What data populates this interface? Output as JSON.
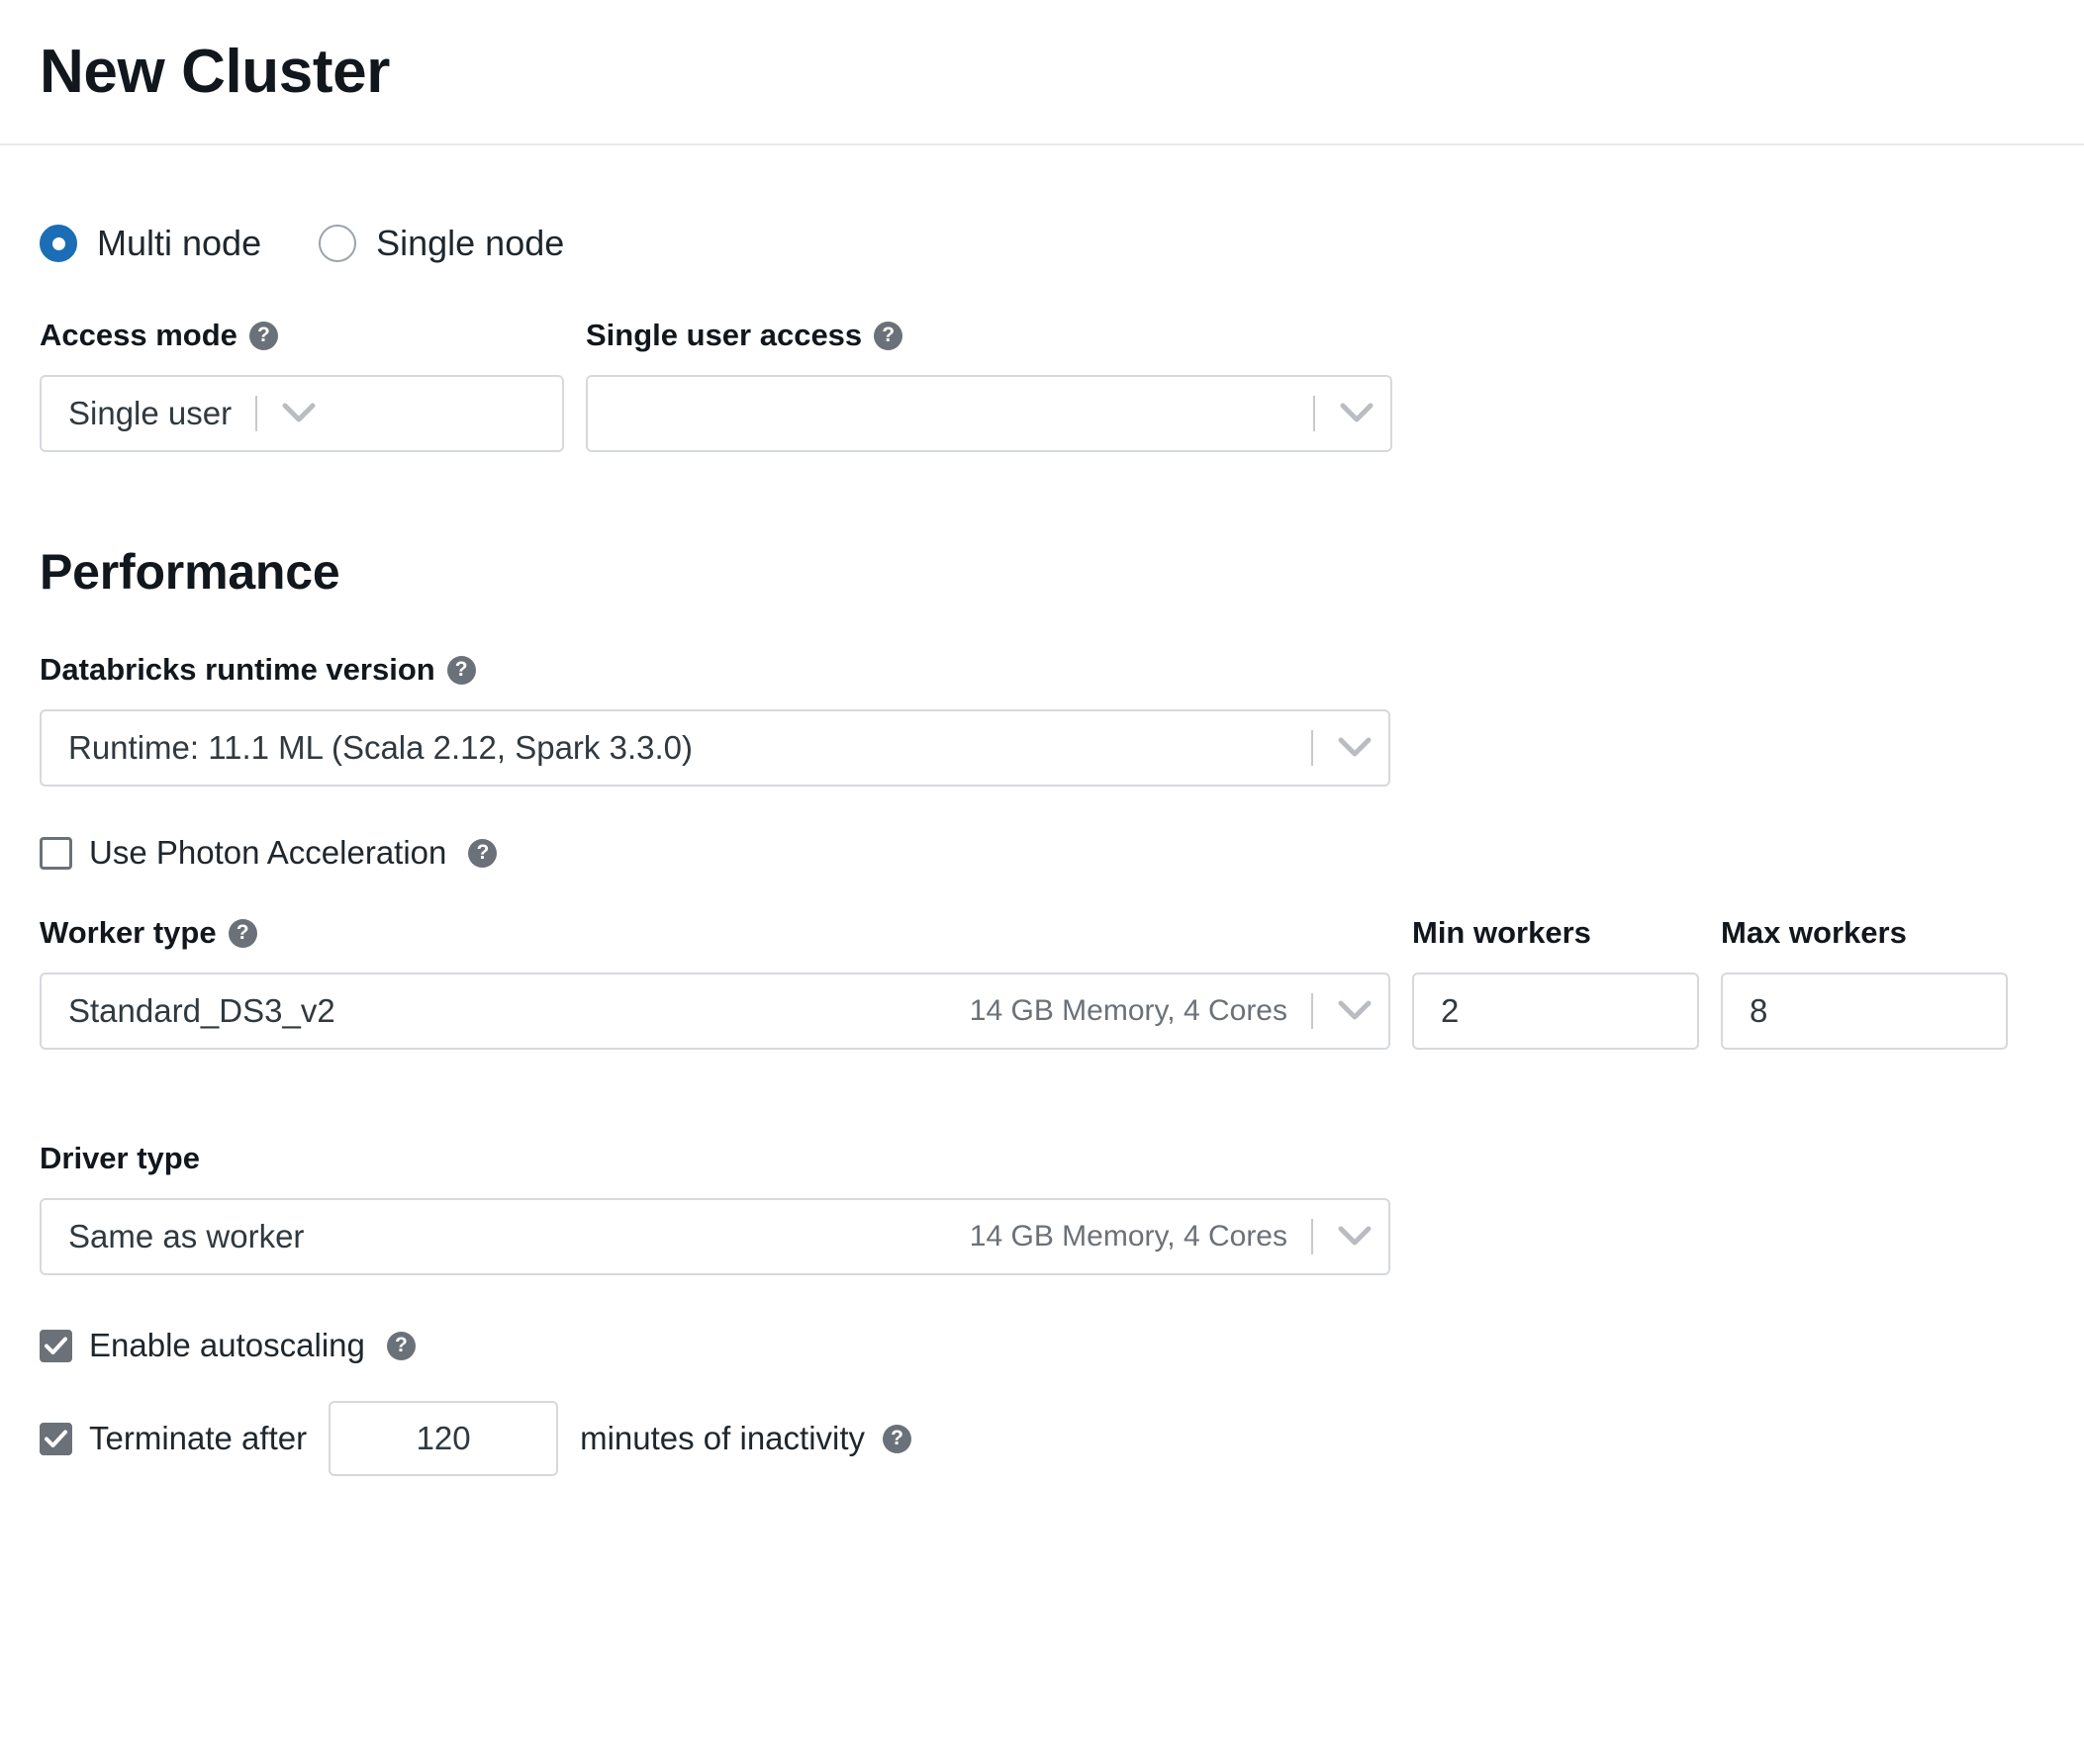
{
  "header": {
    "title": "New Cluster"
  },
  "cluster_mode": {
    "options": [
      {
        "label": "Multi node",
        "selected": true
      },
      {
        "label": "Single node",
        "selected": false
      }
    ]
  },
  "access": {
    "access_mode": {
      "label": "Access mode",
      "value": "Single user",
      "help": "?"
    },
    "single_user_access": {
      "label": "Single user access",
      "value": "",
      "help": "?"
    }
  },
  "performance": {
    "heading": "Performance",
    "runtime": {
      "label": "Databricks runtime version",
      "value": "Runtime: 11.1 ML (Scala 2.12, Spark 3.3.0)",
      "help": "?"
    },
    "photon": {
      "label": "Use Photon Acceleration",
      "checked": false,
      "help": "?"
    },
    "worker_type": {
      "label": "Worker type",
      "value": "Standard_DS3_v2",
      "meta": "14 GB Memory, 4 Cores",
      "help": "?"
    },
    "min_workers": {
      "label": "Min workers",
      "value": "2"
    },
    "max_workers": {
      "label": "Max workers",
      "value": "8"
    },
    "driver_type": {
      "label": "Driver type",
      "value": "Same as worker",
      "meta": "14 GB Memory, 4 Cores"
    },
    "autoscaling": {
      "label": "Enable autoscaling",
      "checked": true,
      "help": "?"
    },
    "terminate": {
      "label": "Terminate after",
      "checked": true,
      "value": "120",
      "suffix": "minutes of inactivity",
      "help": "?"
    }
  },
  "colors": {
    "radio_selected": "#1b6eb5",
    "checkbox_checked": "#6b7178",
    "help_icon": "#6b7178",
    "border": "#d6d9dc",
    "text": "#1f272d"
  }
}
